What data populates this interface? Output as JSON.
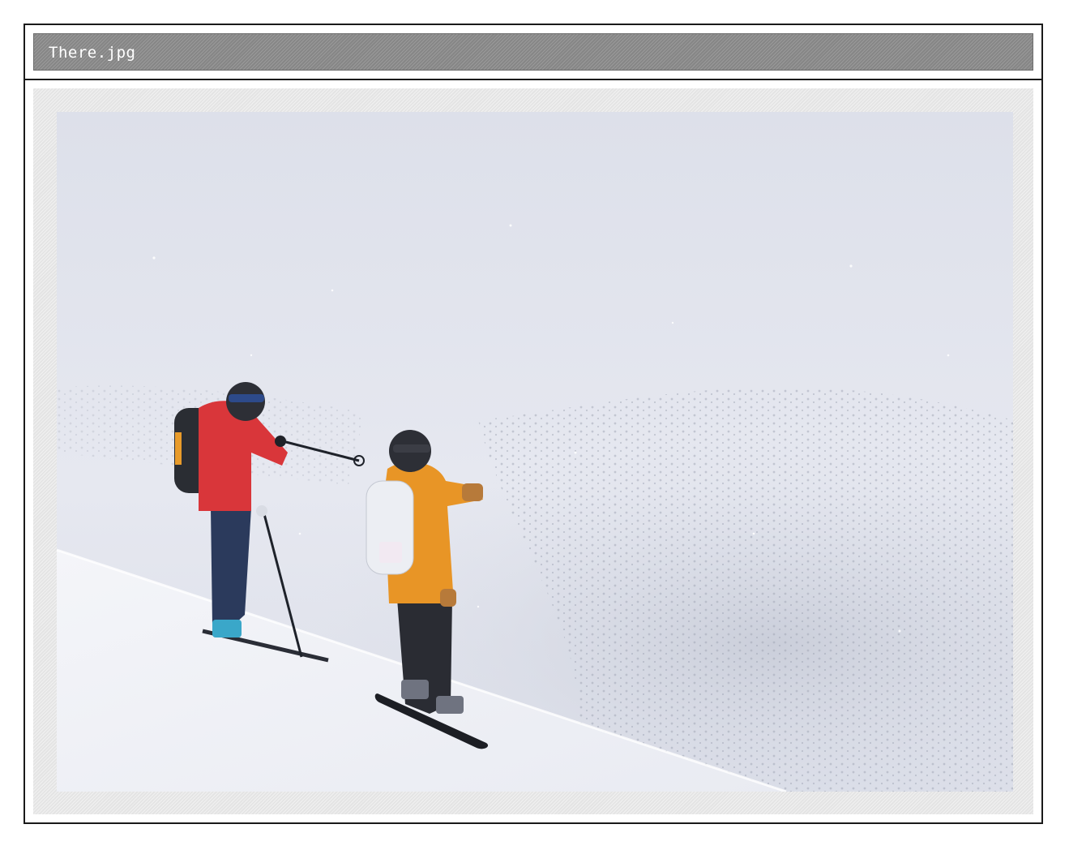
{
  "window": {
    "title": "There.jpg"
  },
  "image": {
    "subject": "photo-ski-snowboard-ridge"
  }
}
